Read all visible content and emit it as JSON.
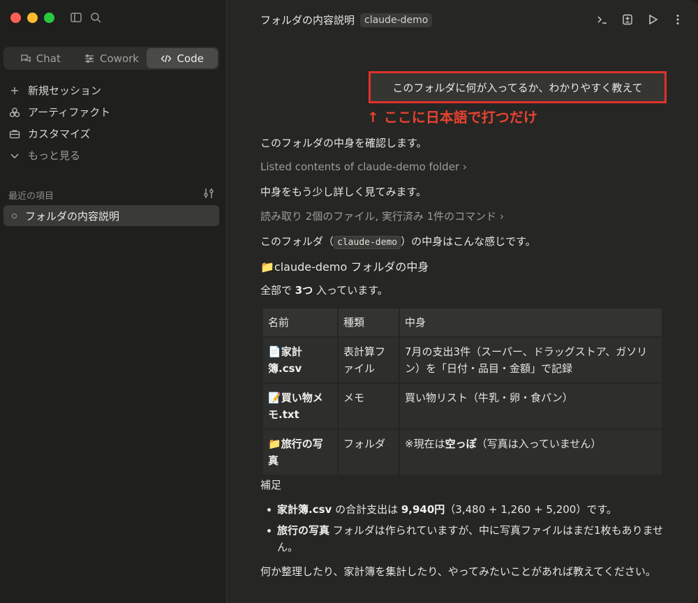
{
  "sidebar": {
    "mode_tabs": [
      {
        "label": "Chat",
        "icon": "chat-bubbles-icon"
      },
      {
        "label": "Cowork",
        "icon": "cowork-sliders-icon"
      },
      {
        "label": "Code",
        "icon": "code-brackets-icon",
        "active": true
      }
    ],
    "nav": [
      {
        "label": "新規セッション",
        "icon": "plus-icon"
      },
      {
        "label": "アーティファクト",
        "icon": "artifact-shapes-icon"
      },
      {
        "label": "カスタマイズ",
        "icon": "briefcase-icon"
      },
      {
        "label": "もっと見る",
        "icon": "chevron-down-icon"
      }
    ],
    "recent_label": "最近の項目",
    "recent_items": [
      {
        "label": "フォルダの内容説明"
      }
    ]
  },
  "header": {
    "title": "フォルダの内容説明",
    "chip": "claude-demo"
  },
  "conversation": {
    "user_message": "このフォルダに何が入ってるか、わかりやすく教えて",
    "annotation": "↑ ここに日本語で打つだけ",
    "line1": "このフォルダの中身を確認します。",
    "tool1": "Listed contents of claude-demo folder",
    "line2": "中身をもう少し詳しく見てみます。",
    "tool2": "読み取り 2個のファイル, 実行済み 1件のコマンド",
    "line3_pre": "このフォルダ（",
    "line3_code": "claude-demo",
    "line3_post": "）の中身はこんな感じです。",
    "heading": "claude-demo フォルダの中身",
    "count_pre": "全部で ",
    "count_bold": "3つ",
    "count_post": " 入っています。",
    "table": {
      "headers": [
        "名前",
        "種類",
        "中身"
      ],
      "rows": [
        {
          "icon": "📄",
          "name": "家計簿.csv",
          "type": "表計算ファイル",
          "content": "7月の支出3件（スーパー、ドラッグストア、ガソリン）を「日付・品目・金額」で記録"
        },
        {
          "icon": "📝",
          "name": "買い物メモ.txt",
          "type": "メモ",
          "content": "買い物リスト（牛乳・卵・食パン）"
        },
        {
          "icon": "📁",
          "name": "旅行の写真",
          "type": "フォルダ",
          "content_pre": "※現在は",
          "content_bold": "空っぽ",
          "content_post": "（写真は入っていません）"
        }
      ]
    },
    "notes_label": "補足",
    "bullet1_b1": "家計簿.csv",
    "bullet1_t1": " の合計支出は ",
    "bullet1_b2": "9,940円",
    "bullet1_t2": "（3,480 + 1,260 + 5,200）です。",
    "bullet2_b1": "旅行の写真",
    "bullet2_t1": " フォルダは作られていますが、中に写真ファイルはまだ1枚もありません。",
    "closing": "何か整理したり、家計簿を集計したり、やってみたいことがあれば教えてください。"
  },
  "colors": {
    "accent_red": "#e0322a",
    "annotation_red": "#e84330"
  }
}
